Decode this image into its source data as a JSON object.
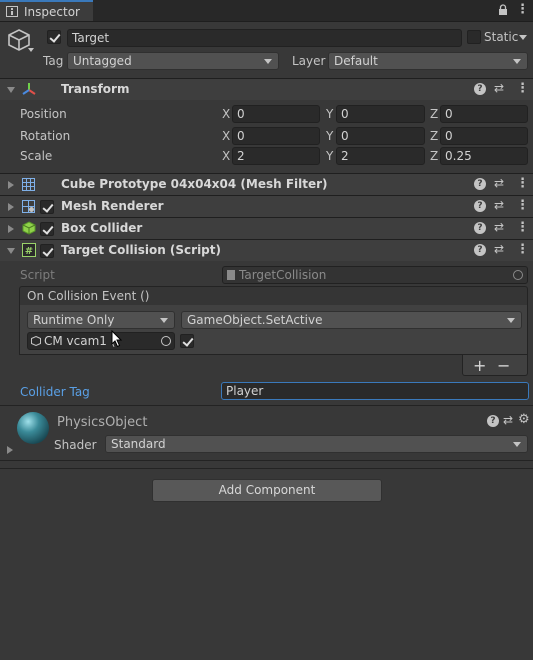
{
  "window": {
    "tab_title": "Inspector",
    "menu_glyph": "⋮"
  },
  "object": {
    "name": "Target",
    "active": true,
    "static_label": "Static",
    "static_checked": false,
    "tag_label": "Tag",
    "tag_value": "Untagged",
    "layer_label": "Layer",
    "layer_value": "Default"
  },
  "transform": {
    "title": "Transform",
    "rows": [
      {
        "label": "Position",
        "x": "0",
        "y": "0",
        "z": "0"
      },
      {
        "label": "Rotation",
        "x": "0",
        "y": "0",
        "z": "0"
      },
      {
        "label": "Scale",
        "x": "2",
        "y": "2",
        "z": "0.25"
      }
    ],
    "axis_x": "X",
    "axis_y": "Y",
    "axis_z": "Z"
  },
  "components": [
    {
      "title": "Cube Prototype 04x04x04 (Mesh Filter)",
      "has_checkbox": false,
      "icon": "grid-icon"
    },
    {
      "title": "Mesh Renderer",
      "has_checkbox": true,
      "enabled": true,
      "icon": "mesh-renderer-icon"
    },
    {
      "title": "Box Collider",
      "has_checkbox": true,
      "enabled": true,
      "icon": "box-collider-icon"
    }
  ],
  "script_component": {
    "title": "Target Collision (Script)",
    "enabled": true,
    "script_label": "Script",
    "script_value": "TargetCollision",
    "event_label": "On Collision Event ()",
    "runtime_value": "Runtime Only",
    "function_value": "GameObject.SetActive",
    "object_value": "CM vcam1 (",
    "param_checked": true,
    "add_label": "+",
    "remove_label": "−",
    "collider_tag_label": "Collider Tag",
    "collider_tag_value": "Player"
  },
  "material": {
    "name": "PhysicsObject",
    "shader_label": "Shader",
    "shader_value": "Standard"
  },
  "add_component_label": "Add Component",
  "colors": {
    "background": "#383838",
    "accent": "#3a79bb",
    "link_blue": "#5aa0e6"
  }
}
